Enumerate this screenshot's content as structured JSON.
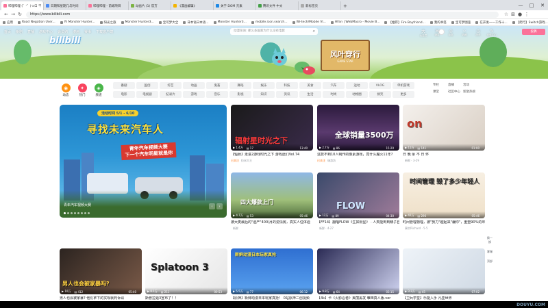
{
  "browser": {
    "tabs": [
      {
        "label": "哔哩哔哩 (゜-゜)つロ 干杯~-bilibili",
        "active": true
      },
      {
        "label": "日期和星期几与时间"
      },
      {
        "label": "哔哩哔哩 - 前端项目"
      },
      {
        "label": "动画片 (1) 官方"
      },
      {
        "label": "《漫画编辑》"
      },
      {
        "label": "关于 DOM 元素"
      },
      {
        "label": "腾讯文件 中文"
      },
      {
        "label": "新标签页"
      }
    ],
    "url": "https://www.bilibili.com",
    "window_controls": [
      "—",
      "□",
      "✕"
    ],
    "bookmarks": [
      "应用",
      "Road Negation User...",
      "IV Monster Hunter...",
      "阳光之旅",
      "Monster Hunter3...",
      "宝可梦大全",
      "日本语日本语...",
      "Monster Hunter3...",
      "mobile.icon.search...",
      "Wi-tech/Mobile Vi...",
      "HFan | WebMacro - Movie B...",
      "【推荐】Fire Boyfriend...",
      "我的书签",
      "宝可梦图鉴",
      "在开发一一工作十...",
      "【爬行】Switch游戏...",
      "B站 ... 教程"
    ]
  },
  "header": {
    "nav_links": [
      "首页",
      "番剧",
      "直播",
      "游戏中心",
      "会员购",
      "漫画",
      "赛事",
      "下载客户端"
    ],
    "search_placeholder": "动漫花语: 那么多国家为什么没有电影",
    "right_nav": [
      {
        "icon": "大",
        "label": "大会员"
      },
      {
        "icon": "✉",
        "label": "消息"
      },
      {
        "icon": "◎",
        "label": "动态"
      },
      {
        "icon": "☆",
        "label": "收藏"
      },
      {
        "icon": "◷",
        "label": "历史"
      },
      {
        "icon": "✎",
        "label": "创作中心"
      }
    ],
    "upload_label": "投稿",
    "logo_text": "bilibili",
    "sign_title": "风叶穿行",
    "sign_subtitle": "GAME STAR"
  },
  "channels": {
    "big_icons": [
      {
        "label": "动态",
        "color": "#ff9212",
        "glyph": "◉"
      },
      {
        "label": "热门",
        "color": "#f9445f",
        "glyph": "🔥"
      },
      {
        "label": "频道",
        "color": "#4ab64a",
        "glyph": "◈"
      }
    ],
    "chips": [
      "番剧",
      "国创",
      "综艺",
      "动画",
      "鬼畜",
      "舞蹈",
      "娱乐",
      "科技",
      "美食",
      "汽车",
      "运动",
      "VLOG",
      "单机游戏",
      "电影",
      "电视剧",
      "纪录片",
      "游戏",
      "音乐",
      "影视",
      "知识",
      "资讯",
      "生活",
      "时尚",
      "动物圈",
      "搞笑",
      "更多"
    ],
    "right_links": [
      "专栏",
      "直播",
      "活动",
      "课堂",
      "社区中心",
      "新歌热榜"
    ]
  },
  "carousel": {
    "badge": "活动时间 5/1 - 6/10",
    "title": "寻找未来汽车人",
    "subtitle_line1": "青年汽车视频大赛",
    "subtitle_line2": "下一个汽车明星就是你",
    "caption": "青年汽车视频大赛",
    "dots": 8,
    "arrows": [
      "‹",
      "›"
    ]
  },
  "videos": [
    {
      "title": "【辐射】走进2游戏时光之下 游戏迷们Vol.74",
      "meta": "拉米大王",
      "tag": "已关注",
      "views": "1.4万",
      "danmaku": "17",
      "duration": "13:40",
      "overlay": "辐射星时光之下"
    },
    {
      "title": "这款不到10人制作的像素游戏，竟什么魔火11年?",
      "meta": "瑞游坊",
      "tag": "已关注",
      "views": "2.7万",
      "danmaku": "86",
      "duration": "15:20",
      "overlay": "全球销量3500万"
    },
    {
      "title": "日 晚 余 不 日 怀",
      "meta": "新鲜 · 3-29",
      "tag": "",
      "views": "11万",
      "danmaku": "141",
      "duration": "01:00",
      "overlay": "on"
    },
    {
      "title": "被大麦最后的\"遗产\"400/月的爱情房，真实人住体验",
      "meta": "新鲜",
      "tag": "",
      "views": "4.7万",
      "danmaku": "53",
      "duration": "05:46",
      "overlay": "四大爆款上门"
    },
    {
      "title": "【FF14】翻唱FLOW《生如衔星》 · 人类能到到精子自己的吗!",
      "meta": "新鲜 · 4-27",
      "tag": "",
      "views": "12万",
      "danmaku": "89",
      "duration": "04:30",
      "overlay": "FLOW"
    },
    {
      "title": "时间管理物理，被\"努力\"越起来\"骗你\"，重塑90%的年轻人? 1组讲给解释 · 一带我第[上拍到我]",
      "meta": "事实Richard · 5-5",
      "tag": "",
      "views": "42万",
      "danmaku": "296",
      "duration": "05:46",
      "overlay": "时间管理 毁了多少年轻人"
    },
    {
      "title": "男人也会被家暴? 他们拿下的实现就判诉讼",
      "meta": "新鲜",
      "tag": "",
      "views": "10万",
      "danmaku": "412",
      "duration": "05:40",
      "overlay": "男人也会被家暴吗?"
    },
    {
      "title": "斯普拉遁3宣布了！！",
      "meta": "新鲜",
      "tag": "",
      "views": "8.1万",
      "danmaku": "211",
      "duration": "00:53",
      "overlay": "Splatoon 3"
    },
    {
      "title": "【原神】新鲜动漫日本玩家真抢！ 0站原神二创视频",
      "meta": "新鲜",
      "tag": "",
      "views": "5.5万",
      "danmaku": "77",
      "duration": "06:12",
      "overlay": "新鲜动漫日本玩家真抢"
    },
    {
      "title": "【4k】卡《火影忍者》美丽黑发 雏田真人版.ver",
      "meta": "新鲜",
      "tag": "",
      "views": "9.8万",
      "danmaku": "64",
      "duration": "03:15",
      "overlay": ""
    },
    {
      "title": "【卫兵学堂】乐能入手 凡亚世界",
      "meta": "新鲜",
      "tag": "",
      "views": "3.3万",
      "danmaku": "45",
      "duration": "07:02",
      "overlay": ""
    }
  ],
  "side_tools": [
    "换一换",
    "客服",
    "顶部"
  ],
  "watermark": "DOUYU.COM"
}
